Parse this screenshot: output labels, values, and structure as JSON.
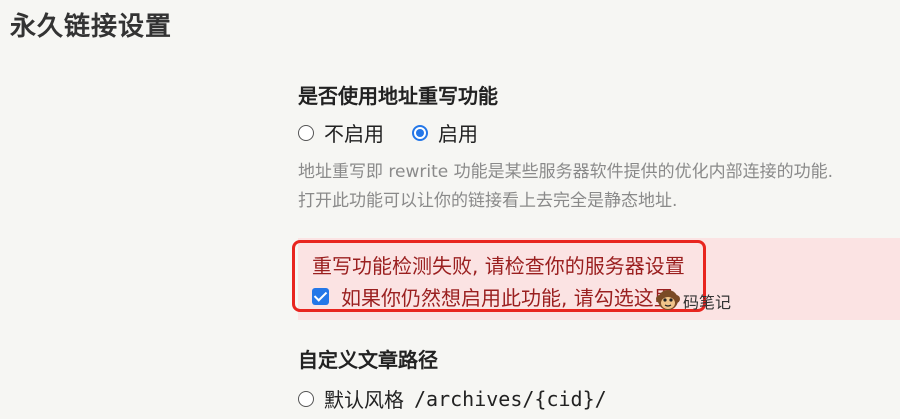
{
  "page": {
    "title": "永久链接设置"
  },
  "rewrite": {
    "title": "是否使用地址重写功能",
    "options": [
      {
        "label": "不启用",
        "checked": false
      },
      {
        "label": "启用",
        "checked": true
      }
    ],
    "description_line1": "地址重写即 rewrite 功能是某些服务器软件提供的优化内部连接的功能.",
    "description_line2": "打开此功能可以让你的链接看上去完全是静态地址."
  },
  "warning": {
    "message": "重写功能检测失败, 请检查你的服务器设置",
    "checkbox_label": "如果你仍然想启用此功能, 请勾选这里",
    "checkbox_checked": true,
    "highlight_color": "#e8251f"
  },
  "watermark": {
    "text": "码笔记",
    "icon": "monkey-icon"
  },
  "path": {
    "title": "自定义文章路径",
    "options": [
      {
        "label": "默认风格",
        "value": "/archives/{cid}/",
        "checked": false
      }
    ]
  },
  "colors": {
    "accent": "#2477e8",
    "warning_text": "#9a1f1f",
    "warning_band": "#fbe3e3"
  }
}
